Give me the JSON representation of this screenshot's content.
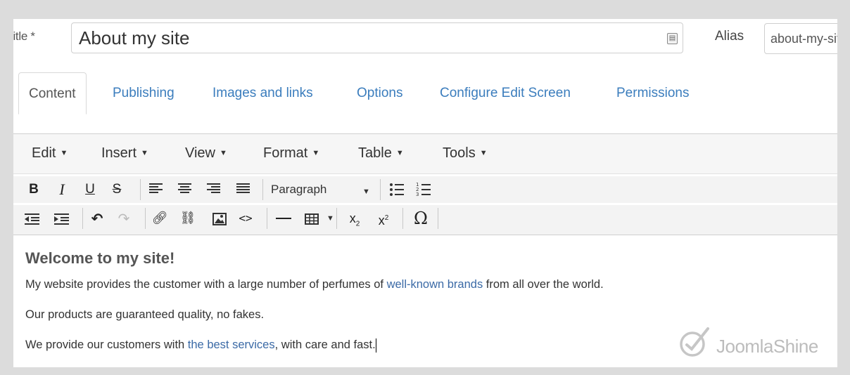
{
  "title_field": {
    "label": "Title *",
    "value": "About my site"
  },
  "alias_field": {
    "label": "Alias",
    "value": "about-my-site"
  },
  "tabs": [
    {
      "label": "Content",
      "active": true
    },
    {
      "label": "Publishing"
    },
    {
      "label": "Images and links"
    },
    {
      "label": "Options"
    },
    {
      "label": "Configure Edit Screen"
    },
    {
      "label": "Permissions"
    }
  ],
  "menubar": [
    "Edit",
    "Insert",
    "View",
    "Format",
    "Table",
    "Tools"
  ],
  "toolbar": {
    "bold": "B",
    "italic": "I",
    "underline": "U",
    "strike": "S",
    "format_select": "Paragraph",
    "omega": "Ω"
  },
  "content": {
    "heading": "Welcome to my site!",
    "p1_pre": "My website provides the customer with a large number of perfumes of ",
    "p1_link": "well-known brands",
    "p1_post": " from all over the world.",
    "p2": "Our products are guaranteed quality, no fakes.",
    "p3_pre": "We provide our customers with ",
    "p3_link": "the best services",
    "p3_post": ", with care and fast."
  },
  "watermark": {
    "text": "JoomlaShine"
  },
  "colors": {
    "link": "#3b7dbd",
    "content_link": "#3b6aa6",
    "watermark": "#bcbcbc"
  }
}
